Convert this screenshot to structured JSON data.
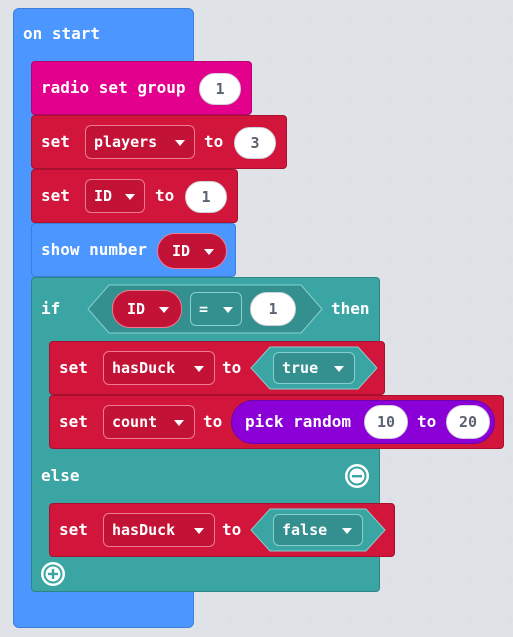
{
  "on_start": {
    "label": "on start"
  },
  "radio": {
    "label": "radio set group",
    "value": "1"
  },
  "set_players": {
    "set": "set",
    "var": "players",
    "to": "to",
    "value": "3"
  },
  "set_id": {
    "set": "set",
    "var": "ID",
    "to": "to",
    "value": "1"
  },
  "show_number": {
    "label": "show number",
    "var": "ID"
  },
  "if_block": {
    "if": "if",
    "var": "ID",
    "op": "=",
    "value": "1",
    "then": "then",
    "else": "else"
  },
  "set_hasduck_true": {
    "set": "set",
    "var": "hasDuck",
    "to": "to",
    "value": "true"
  },
  "set_count": {
    "set": "set",
    "var": "count",
    "to": "to",
    "func": "pick random",
    "from": "10",
    "to2": "to",
    "upto": "20"
  },
  "set_hasduck_false": {
    "set": "set",
    "var": "hasDuck",
    "to": "to",
    "value": "false"
  },
  "colors": {
    "blue": "#4c97ff",
    "pink": "#e3008c",
    "red": "#d1153b",
    "teal": "#3ba5a4",
    "purple": "#8a00d6"
  },
  "icons": [
    "remove-else-icon",
    "add-else-icon",
    "dropdown-caret-icon"
  ]
}
